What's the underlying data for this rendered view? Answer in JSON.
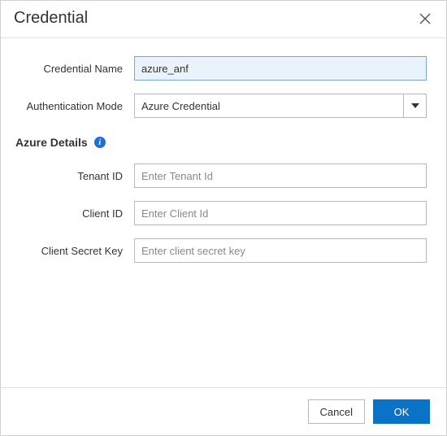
{
  "dialog": {
    "title": "Credential"
  },
  "form": {
    "credential_name": {
      "label": "Credential Name",
      "value": "azure_anf"
    },
    "auth_mode": {
      "label": "Authentication Mode",
      "value": "Azure Credential"
    }
  },
  "section": {
    "title": "Azure Details"
  },
  "azure": {
    "tenant_id": {
      "label": "Tenant ID",
      "placeholder": "Enter Tenant Id",
      "value": ""
    },
    "client_id": {
      "label": "Client ID",
      "placeholder": "Enter Client Id",
      "value": ""
    },
    "client_secret": {
      "label": "Client Secret Key",
      "placeholder": "Enter client secret key",
      "value": ""
    }
  },
  "footer": {
    "cancel": "Cancel",
    "ok": "OK"
  }
}
